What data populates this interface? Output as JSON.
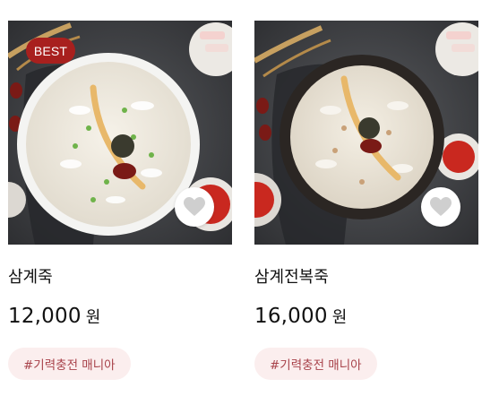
{
  "products": [
    {
      "name": "삼계죽",
      "price": "12,000",
      "currency": "원",
      "badge": "BEST",
      "tag": "#기력충전 매니아",
      "bowl_color": "#f4f4f2"
    },
    {
      "name": "삼계전복죽",
      "price": "16,000",
      "currency": "원",
      "badge": "",
      "tag": "#기력충전 매니아",
      "bowl_color": "#2b2623"
    }
  ],
  "colors": {
    "badge_bg": "#a8201e",
    "tag_bg": "#fbeeee",
    "tag_text": "#a8424a",
    "heart": "#cfcfcf"
  },
  "icons": {
    "wishlist": "heart-icon"
  }
}
